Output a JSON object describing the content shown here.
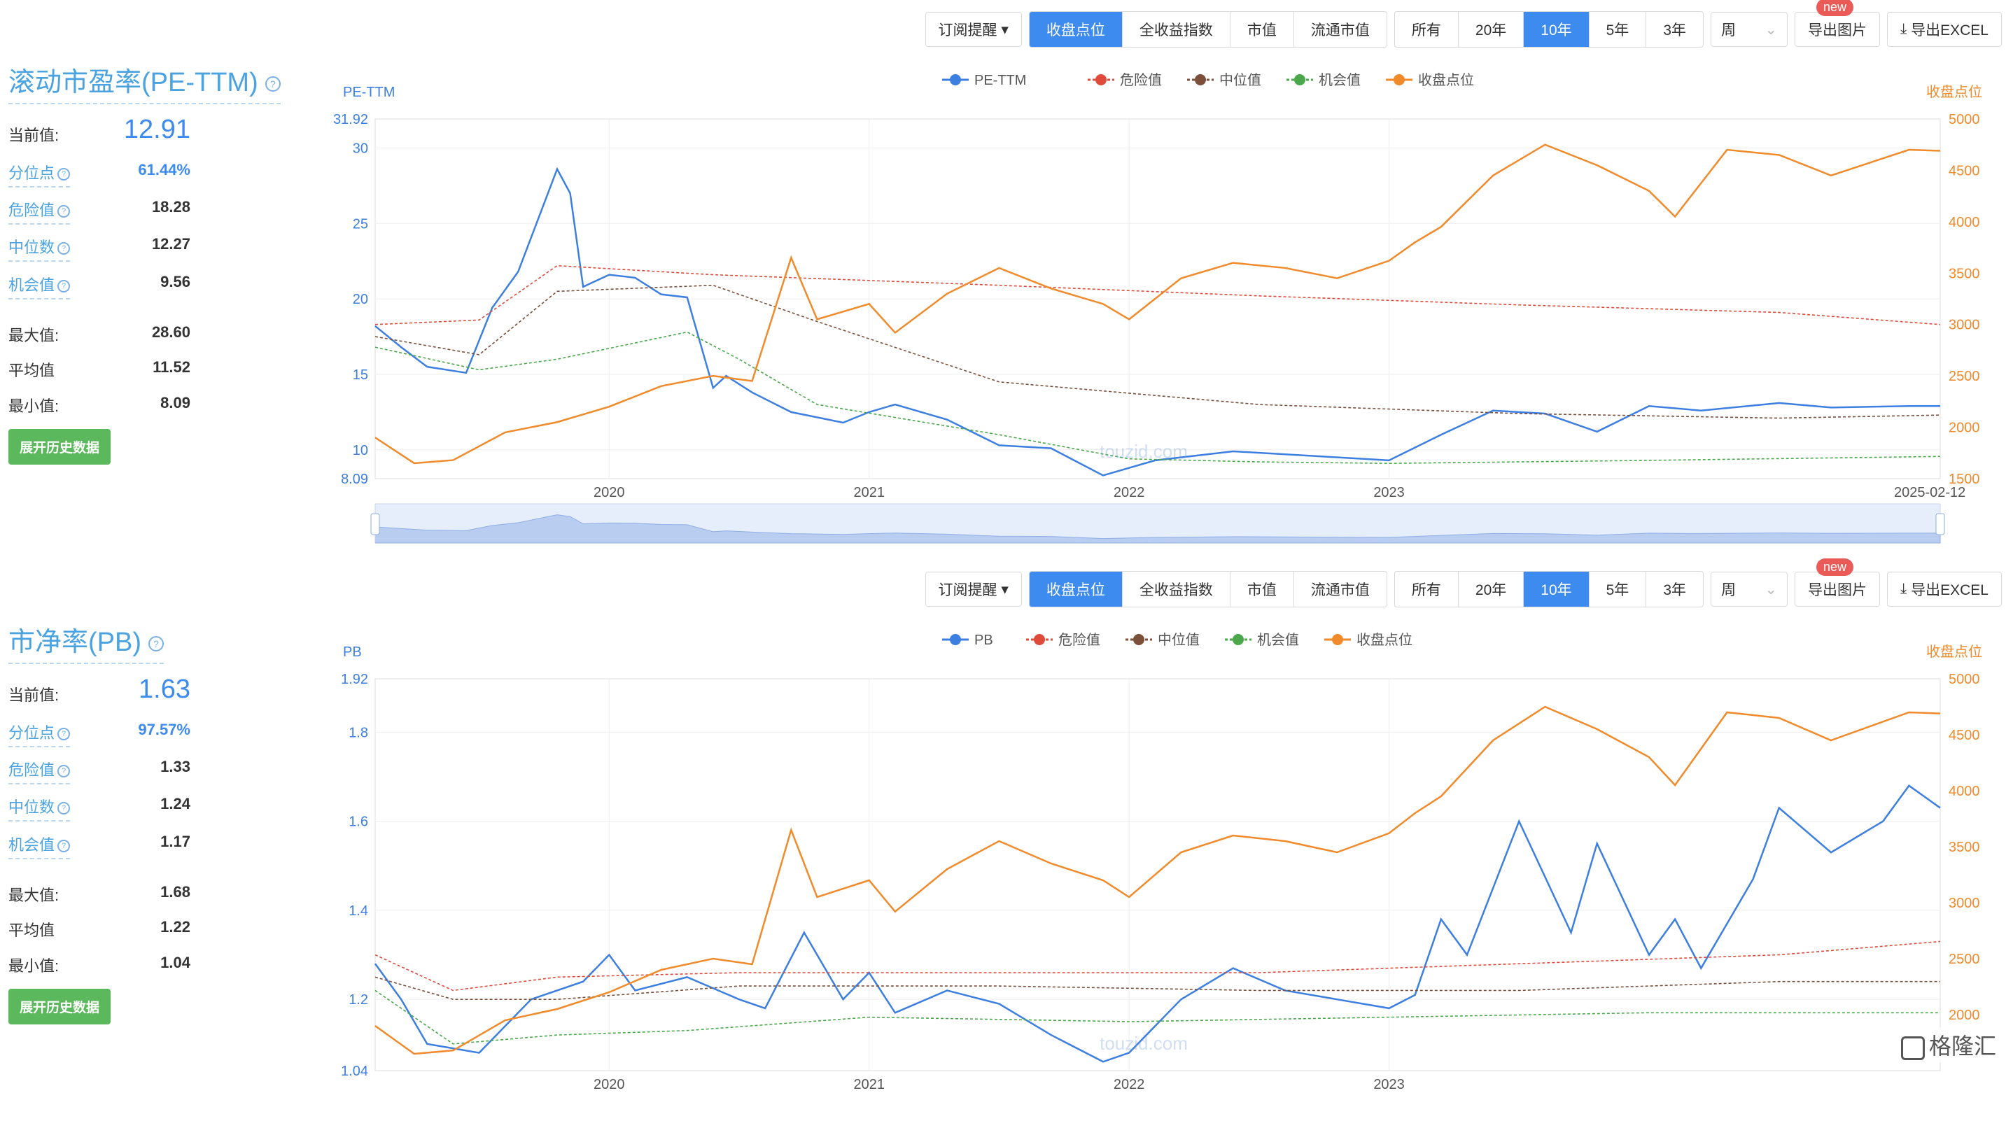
{
  "toolbar": {
    "subscribe": "订阅提醒",
    "measures": [
      "收盘点位",
      "全收益指数",
      "市值",
      "流通市值"
    ],
    "ranges": [
      "所有",
      "20年",
      "10年",
      "5年",
      "3年"
    ],
    "period": "周",
    "new_tag": "new",
    "export_image": "导出图片",
    "export_excel": "导出EXCEL"
  },
  "pe": {
    "title": "滚动市盈率(PE-TTM)",
    "current_label": "当前值:",
    "current": "12.91",
    "percentile_label": "分位点",
    "percentile": "61.44%",
    "danger_label": "危险值",
    "danger": "18.28",
    "median_label": "中位数",
    "median": "12.27",
    "chance_label": "机会值",
    "chance": "9.56",
    "max_label": "最大值:",
    "max": "28.60",
    "avg_label": "平均值",
    "avg": "11.52",
    "min_label": "最小值:",
    "min": "8.09",
    "history_button": "展开历史数据"
  },
  "pb": {
    "title": "市净率(PB)",
    "current_label": "当前值:",
    "current": "1.63",
    "percentile_label": "分位点",
    "percentile": "97.57%",
    "danger_label": "危险值",
    "danger": "1.33",
    "median_label": "中位数",
    "median": "1.24",
    "chance_label": "机会值",
    "chance": "1.17",
    "max_label": "最大值:",
    "max": "1.68",
    "avg_label": "平均值",
    "avg": "1.22",
    "min_label": "最小值:",
    "min": "1.04",
    "history_button": "展开历史数据"
  },
  "watermark": {
    "text": "touzid.com",
    "corner": "格隆汇"
  },
  "colors": {
    "pe": "#3d7fe0",
    "danger": "#e04a3a",
    "median": "#7b4f3a",
    "chance": "#4aa84a",
    "close": "#f08a2a",
    "accent": "#3d8bef"
  },
  "chart_data": [
    {
      "type": "line",
      "ylabel": "PE-TTM",
      "y2label": "收盘点位",
      "ylim": [
        8.09,
        31.92
      ],
      "yticks": [
        "31.92",
        "30",
        "25",
        "20",
        "15",
        "10",
        "8.09"
      ],
      "y2lim": [
        1500,
        5000
      ],
      "y2ticks": [
        "5000",
        "4500",
        "4000",
        "3500",
        "3000",
        "2500",
        "2000",
        "1500"
      ],
      "xticks": [
        "2020",
        "2021",
        "2022",
        "2023",
        "2025-02-12"
      ],
      "xlim": [
        2019.1,
        2025.12
      ],
      "legend": [
        "PE-TTM",
        "危险值",
        "中位值",
        "机会值",
        "收盘点位"
      ],
      "series": [
        {
          "name": "PE-TTM",
          "x": [
            2019.1,
            2019.2,
            2019.3,
            2019.45,
            2019.55,
            2019.65,
            2019.8,
            2019.85,
            2019.9,
            2020.0,
            2020.1,
            2020.2,
            2020.3,
            2020.4,
            2020.45,
            2020.55,
            2020.7,
            2020.9,
            2021.0,
            2021.1,
            2021.3,
            2021.5,
            2021.7,
            2021.9,
            2022.1,
            2022.4,
            2022.7,
            2023.0,
            2023.2,
            2023.4,
            2023.6,
            2023.8,
            2024.0,
            2024.2,
            2024.5,
            2024.7,
            2025.0,
            2025.12
          ],
          "y": [
            18.2,
            16.8,
            15.5,
            15.1,
            19.4,
            21.8,
            28.6,
            27.0,
            20.8,
            21.6,
            21.4,
            20.3,
            20.1,
            14.1,
            14.9,
            13.8,
            12.5,
            11.8,
            12.5,
            13.0,
            12.0,
            10.3,
            10.1,
            8.3,
            9.3,
            9.9,
            9.6,
            9.3,
            11.0,
            12.6,
            12.4,
            11.2,
            12.9,
            12.6,
            13.1,
            12.8,
            12.9,
            12.9
          ]
        },
        {
          "name": "危险值",
          "x": [
            2019.1,
            2019.5,
            2019.8,
            2020.4,
            2021.5,
            2022.5,
            2023.5,
            2024.5,
            2025.12
          ],
          "y": [
            18.3,
            18.6,
            22.2,
            21.6,
            20.9,
            20.2,
            19.6,
            19.1,
            18.3
          ]
        },
        {
          "name": "中位值",
          "x": [
            2019.1,
            2019.5,
            2019.8,
            2020.4,
            2020.8,
            2021.5,
            2022.5,
            2023.5,
            2024.5,
            2025.12
          ],
          "y": [
            17.5,
            16.3,
            20.5,
            20.9,
            18.5,
            14.5,
            13.0,
            12.4,
            12.1,
            12.3
          ]
        },
        {
          "name": "机会值",
          "x": [
            2019.1,
            2019.5,
            2019.8,
            2020.3,
            2020.5,
            2020.8,
            2021.5,
            2022.0,
            2022.5,
            2023.0,
            2024.0,
            2025.12
          ],
          "y": [
            16.8,
            15.3,
            16.0,
            17.8,
            16.0,
            13.0,
            11.0,
            9.4,
            9.2,
            9.1,
            9.3,
            9.56
          ]
        },
        {
          "name": "收盘点位",
          "x": [
            2019.1,
            2019.25,
            2019.4,
            2019.6,
            2019.8,
            2020.0,
            2020.2,
            2020.4,
            2020.55,
            2020.7,
            2020.8,
            2021.0,
            2021.1,
            2021.3,
            2021.5,
            2021.7,
            2021.9,
            2022.0,
            2022.2,
            2022.4,
            2022.6,
            2022.8,
            2023.0,
            2023.1,
            2023.2,
            2023.4,
            2023.6,
            2023.8,
            2024.0,
            2024.1,
            2024.3,
            2024.5,
            2024.7,
            2025.0,
            2025.12
          ],
          "y": [
            1900,
            1650,
            1680,
            1950,
            2050,
            2200,
            2400,
            2500,
            2450,
            3650,
            3050,
            3200,
            2920,
            3300,
            3550,
            3350,
            3200,
            3050,
            3450,
            3600,
            3550,
            3450,
            3620,
            3800,
            3950,
            4450,
            4750,
            4550,
            4300,
            4050,
            4700,
            4650,
            4450,
            4700,
            4690
          ]
        }
      ]
    },
    {
      "type": "line",
      "ylabel": "PB",
      "y2label": "收盘点位",
      "ylim": [
        1.04,
        1.92
      ],
      "yticks": [
        "1.92",
        "1.8",
        "1.6",
        "1.4",
        "1.2",
        "1.04"
      ],
      "y2lim": [
        1500,
        5000
      ],
      "y2ticks": [
        "5000",
        "4500",
        "4000",
        "3500",
        "3000",
        "2500",
        "2000"
      ],
      "xticks": [
        "2020",
        "2021",
        "2022",
        "2023"
      ],
      "xlim": [
        2019.1,
        2025.12
      ],
      "legend": [
        "PB",
        "危险值",
        "中位值",
        "机会值",
        "收盘点位"
      ],
      "series": [
        {
          "name": "PB",
          "x": [
            2019.1,
            2019.2,
            2019.3,
            2019.5,
            2019.7,
            2019.9,
            2020.0,
            2020.1,
            2020.3,
            2020.5,
            2020.6,
            2020.75,
            2020.9,
            2021.0,
            2021.1,
            2021.3,
            2021.5,
            2021.7,
            2021.9,
            2022.0,
            2022.2,
            2022.4,
            2022.6,
            2022.8,
            2023.0,
            2023.1,
            2023.2,
            2023.3,
            2023.5,
            2023.7,
            2023.8,
            2024.0,
            2024.1,
            2024.2,
            2024.4,
            2024.5,
            2024.7,
            2024.9,
            2025.0,
            2025.12
          ],
          "y": [
            1.28,
            1.2,
            1.1,
            1.08,
            1.2,
            1.24,
            1.3,
            1.22,
            1.25,
            1.2,
            1.18,
            1.35,
            1.2,
            1.26,
            1.17,
            1.22,
            1.19,
            1.12,
            1.06,
            1.08,
            1.2,
            1.27,
            1.22,
            1.2,
            1.18,
            1.21,
            1.38,
            1.3,
            1.6,
            1.35,
            1.55,
            1.3,
            1.38,
            1.27,
            1.47,
            1.63,
            1.53,
            1.6,
            1.68,
            1.63
          ]
        },
        {
          "name": "危险值",
          "x": [
            2019.1,
            2019.4,
            2019.8,
            2020.5,
            2021.5,
            2022.5,
            2023.5,
            2024.5,
            2025.12
          ],
          "y": [
            1.3,
            1.22,
            1.25,
            1.26,
            1.26,
            1.26,
            1.28,
            1.3,
            1.33
          ]
        },
        {
          "name": "中位值",
          "x": [
            2019.1,
            2019.4,
            2019.8,
            2020.5,
            2021.5,
            2022.5,
            2023.5,
            2024.5,
            2025.12
          ],
          "y": [
            1.25,
            1.2,
            1.2,
            1.23,
            1.23,
            1.22,
            1.22,
            1.24,
            1.24
          ]
        },
        {
          "name": "机会值",
          "x": [
            2019.1,
            2019.4,
            2019.8,
            2020.3,
            2021.0,
            2022.0,
            2023.0,
            2024.0,
            2025.12
          ],
          "y": [
            1.22,
            1.1,
            1.12,
            1.13,
            1.16,
            1.15,
            1.16,
            1.17,
            1.17
          ]
        },
        {
          "name": "收盘点位",
          "x": [
            2019.1,
            2019.25,
            2019.4,
            2019.6,
            2019.8,
            2020.0,
            2020.2,
            2020.4,
            2020.55,
            2020.7,
            2020.8,
            2021.0,
            2021.1,
            2021.3,
            2021.5,
            2021.7,
            2021.9,
            2022.0,
            2022.2,
            2022.4,
            2022.6,
            2022.8,
            2023.0,
            2023.1,
            2023.2,
            2023.4,
            2023.6,
            2023.8,
            2024.0,
            2024.1,
            2024.3,
            2024.5,
            2024.7,
            2025.0,
            2025.12
          ],
          "y": [
            1900,
            1650,
            1680,
            1950,
            2050,
            2200,
            2400,
            2500,
            2450,
            3650,
            3050,
            3200,
            2920,
            3300,
            3550,
            3350,
            3200,
            3050,
            3450,
            3600,
            3550,
            3450,
            3620,
            3800,
            3950,
            4450,
            4750,
            4550,
            4300,
            4050,
            4700,
            4650,
            4450,
            4700,
            4690
          ]
        }
      ]
    }
  ]
}
